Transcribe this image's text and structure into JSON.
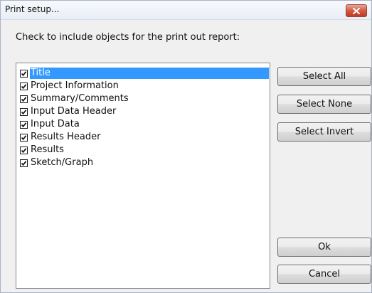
{
  "window": {
    "title": "Print setup...",
    "close_icon": "close-icon"
  },
  "instruction": "Check to include objects for the print out report:",
  "list": {
    "items": [
      {
        "label": "Title",
        "checked": true,
        "selected": true
      },
      {
        "label": "Project Information",
        "checked": true,
        "selected": false
      },
      {
        "label": "Summary/Comments",
        "checked": true,
        "selected": false
      },
      {
        "label": "Input Data Header",
        "checked": true,
        "selected": false
      },
      {
        "label": "Input Data",
        "checked": true,
        "selected": false
      },
      {
        "label": "Results Header",
        "checked": true,
        "selected": false
      },
      {
        "label": "Results",
        "checked": true,
        "selected": false
      },
      {
        "label": "Sketch/Graph",
        "checked": true,
        "selected": false
      }
    ]
  },
  "buttons": {
    "select_all": "Select All",
    "select_none": "Select None",
    "select_invert": "Select Invert",
    "ok": "Ok",
    "cancel": "Cancel"
  },
  "colors": {
    "selection": "#3399ff",
    "close_button": "#c94a32"
  }
}
